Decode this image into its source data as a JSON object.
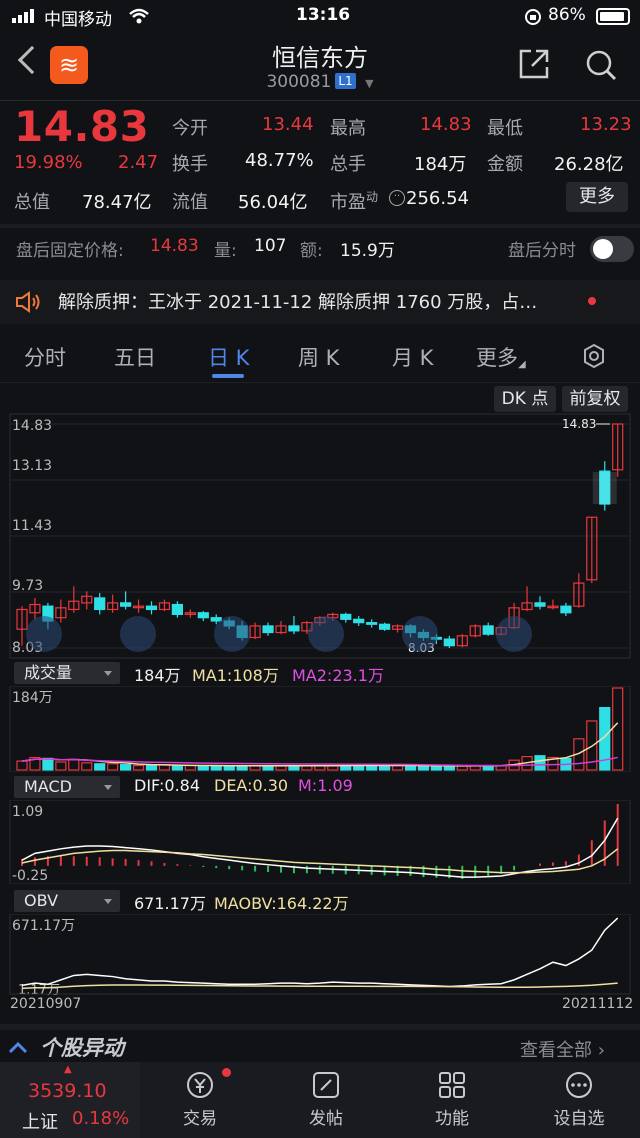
{
  "status": {
    "carrier": "中国移动",
    "time": "13:16",
    "battery": "86%"
  },
  "header": {
    "title": "恒信东方",
    "code": "300081",
    "level": "L1"
  },
  "quote": {
    "price": "14.83",
    "change_pct": "19.98%",
    "change": "2.47",
    "rows": [
      [
        {
          "label": "今开",
          "value": "13.44",
          "color": "red"
        },
        {
          "label": "最高",
          "value": "14.83",
          "color": "red"
        },
        {
          "label": "最低",
          "value": "13.23",
          "color": "red"
        }
      ],
      [
        {
          "label": "换手",
          "value": "48.77%",
          "color": "white"
        },
        {
          "label": "总手",
          "value": "184万",
          "color": "white"
        },
        {
          "label": "金额",
          "value": "26.28亿",
          "color": "white"
        }
      ],
      [
        {
          "label": "总值",
          "value": "78.47亿",
          "color": "white"
        },
        {
          "label": "流值",
          "value": "56.04亿",
          "color": "white"
        },
        {
          "label": "市盈",
          "value": "256.54",
          "color": "white",
          "sup": "动"
        }
      ]
    ],
    "more": "更多"
  },
  "after_hours": {
    "label": "盘后固定价格:",
    "price": "14.83",
    "vol_label": "量:",
    "vol": "107",
    "amt_label": "额:",
    "amt": "15.9万",
    "toggle_label": "盘后分时"
  },
  "notice": {
    "text": "解除质押：王冰于 2021-11-12 解除质押 1760 万股，占…"
  },
  "tabs": [
    "分时",
    "五日",
    "日 K",
    "周 K",
    "月 K",
    "更多"
  ],
  "active_tab": "日 K",
  "chart_buttons": {
    "dk": "DK 点",
    "fq": "前复权"
  },
  "kline": {
    "y_labels": [
      "14.83",
      "13.13",
      "11.43",
      "9.73",
      "8.03"
    ],
    "max_tag": "14.83",
    "min_tag": "8.03",
    "start_date": "20210907",
    "end_date": "20211112"
  },
  "volume": {
    "label": "成交量",
    "value": "184万",
    "ma1": "MA1:108万",
    "ma2": "MA2:23.1万",
    "y_top": "184万"
  },
  "macd": {
    "label": "MACD",
    "dif": "DIF:0.84",
    "dea": "DEA:0.30",
    "m": "M:1.09",
    "y_top": "1.09",
    "y_bottom": "-0.25"
  },
  "obv": {
    "label": "OBV",
    "value": "671.17万",
    "maobv": "MAOBV:164.22万",
    "y_top": "671.17万",
    "y_bottom": "1.17万"
  },
  "bottom_section": {
    "title": "个股异动",
    "link": "查看全部"
  },
  "bottom_nav": {
    "index_value": "3539.10",
    "index_name": "上证",
    "index_pct": "0.18%",
    "items": [
      "交易",
      "发帖",
      "功能",
      "设自选"
    ]
  },
  "colors": {
    "up": "#e8383d",
    "down": "#2ee0e6",
    "accent": "#4f86e8",
    "ma1": "#f0e0a0",
    "ma2": "#d63ad6"
  },
  "chart_data": {
    "type": "candlestick",
    "ylim": [
      8.03,
      14.83
    ],
    "candles": [
      {
        "o": 8.6,
        "c": 9.2,
        "h": 9.3,
        "l": 8.1
      },
      {
        "o": 9.1,
        "c": 9.35,
        "h": 9.55,
        "l": 8.9
      },
      {
        "o": 9.3,
        "c": 8.85,
        "h": 9.4,
        "l": 8.6
      },
      {
        "o": 8.95,
        "c": 9.25,
        "h": 9.5,
        "l": 8.8
      },
      {
        "o": 9.2,
        "c": 9.45,
        "h": 9.9,
        "l": 9.1
      },
      {
        "o": 9.4,
        "c": 9.6,
        "h": 9.75,
        "l": 9.2
      },
      {
        "o": 9.55,
        "c": 9.2,
        "h": 9.7,
        "l": 9.05
      },
      {
        "o": 9.2,
        "c": 9.4,
        "h": 9.65,
        "l": 9.1
      },
      {
        "o": 9.4,
        "c": 9.3,
        "h": 9.75,
        "l": 9.2
      },
      {
        "o": 9.3,
        "c": 9.3,
        "h": 9.5,
        "l": 9.1
      },
      {
        "o": 9.3,
        "c": 9.2,
        "h": 9.45,
        "l": 9.05
      },
      {
        "o": 9.2,
        "c": 9.4,
        "h": 9.5,
        "l": 9.15
      },
      {
        "o": 9.35,
        "c": 9.05,
        "h": 9.45,
        "l": 8.95
      },
      {
        "o": 9.05,
        "c": 9.1,
        "h": 9.2,
        "l": 8.95
      },
      {
        "o": 9.1,
        "c": 8.95,
        "h": 9.15,
        "l": 8.85
      },
      {
        "o": 8.95,
        "c": 8.85,
        "h": 9.05,
        "l": 8.75
      },
      {
        "o": 8.85,
        "c": 8.7,
        "h": 8.95,
        "l": 8.6
      },
      {
        "o": 8.7,
        "c": 8.35,
        "h": 8.85,
        "l": 8.25
      },
      {
        "o": 8.35,
        "c": 8.7,
        "h": 8.8,
        "l": 8.3
      },
      {
        "o": 8.7,
        "c": 8.5,
        "h": 8.8,
        "l": 8.4
      },
      {
        "o": 8.5,
        "c": 8.7,
        "h": 8.85,
        "l": 8.45
      },
      {
        "o": 8.7,
        "c": 8.55,
        "h": 9.0,
        "l": 8.45
      },
      {
        "o": 8.55,
        "c": 8.8,
        "h": 8.85,
        "l": 8.45
      },
      {
        "o": 8.8,
        "c": 8.95,
        "h": 9.0,
        "l": 8.7
      },
      {
        "o": 8.95,
        "c": 9.05,
        "h": 9.1,
        "l": 8.85
      },
      {
        "o": 9.05,
        "c": 8.9,
        "h": 9.1,
        "l": 8.8
      },
      {
        "o": 8.9,
        "c": 8.8,
        "h": 9.0,
        "l": 8.7
      },
      {
        "o": 8.8,
        "c": 8.75,
        "h": 8.9,
        "l": 8.65
      },
      {
        "o": 8.75,
        "c": 8.6,
        "h": 8.8,
        "l": 8.55
      },
      {
        "o": 8.6,
        "c": 8.7,
        "h": 8.75,
        "l": 8.5
      },
      {
        "o": 8.7,
        "c": 8.5,
        "h": 8.75,
        "l": 8.35
      },
      {
        "o": 8.5,
        "c": 8.35,
        "h": 8.6,
        "l": 8.25
      },
      {
        "o": 8.35,
        "c": 8.3,
        "h": 8.45,
        "l": 8.15
      },
      {
        "o": 8.3,
        "c": 8.1,
        "h": 8.4,
        "l": 8.03
      },
      {
        "o": 8.1,
        "c": 8.4,
        "h": 8.45,
        "l": 8.05
      },
      {
        "o": 8.4,
        "c": 8.7,
        "h": 8.75,
        "l": 8.35
      },
      {
        "o": 8.7,
        "c": 8.45,
        "h": 8.8,
        "l": 8.4
      },
      {
        "o": 8.45,
        "c": 8.65,
        "h": 8.7,
        "l": 8.4
      },
      {
        "o": 8.65,
        "c": 9.25,
        "h": 9.4,
        "l": 8.6
      },
      {
        "o": 9.2,
        "c": 9.4,
        "h": 9.9,
        "l": 9.15
      },
      {
        "o": 9.4,
        "c": 9.3,
        "h": 9.6,
        "l": 9.2
      },
      {
        "o": 9.3,
        "c": 9.3,
        "h": 9.5,
        "l": 9.2
      },
      {
        "o": 9.3,
        "c": 9.1,
        "h": 9.4,
        "l": 9.0
      },
      {
        "o": 9.3,
        "c": 10.0,
        "h": 10.3,
        "l": 9.25
      },
      {
        "o": 10.1,
        "c": 12.0,
        "h": 12.0,
        "l": 10.0
      },
      {
        "o": 13.4,
        "c": 12.4,
        "h": 13.7,
        "l": 12.2
      },
      {
        "o": 13.44,
        "c": 14.83,
        "h": 14.83,
        "l": 13.23
      }
    ],
    "volume_max": 184,
    "volumes": [
      20,
      28,
      26,
      18,
      24,
      16,
      14,
      14,
      12,
      10,
      10,
      12,
      10,
      10,
      9,
      9,
      10,
      10,
      10,
      9,
      9,
      9,
      10,
      10,
      10,
      10,
      10,
      10,
      10,
      10,
      10,
      9,
      9,
      9,
      9,
      10,
      10,
      10,
      22,
      30,
      32,
      28,
      26,
      70,
      110,
      140,
      184
    ],
    "macd_bars": [
      0.12,
      0.15,
      0.17,
      0.18,
      0.17,
      0.16,
      0.15,
      0.13,
      0.12,
      0.1,
      0.08,
      0.05,
      0.03,
      0.01,
      -0.02,
      -0.04,
      -0.06,
      -0.08,
      -0.1,
      -0.11,
      -0.12,
      -0.13,
      -0.13,
      -0.14,
      -0.14,
      -0.15,
      -0.15,
      -0.16,
      -0.17,
      -0.18,
      -0.18,
      -0.2,
      -0.21,
      -0.22,
      -0.23,
      -0.21,
      -0.18,
      -0.14,
      -0.08,
      0.0,
      0.04,
      0.06,
      0.08,
      0.2,
      0.45,
      0.8,
      1.09
    ],
    "dif": [
      0.1,
      0.22,
      0.26,
      0.3,
      0.33,
      0.35,
      0.35,
      0.34,
      0.32,
      0.3,
      0.28,
      0.25,
      0.22,
      0.2,
      0.16,
      0.13,
      0.1,
      0.07,
      0.04,
      0.02,
      0.0,
      -0.02,
      -0.04,
      -0.05,
      -0.06,
      -0.07,
      -0.08,
      -0.09,
      -0.1,
      -0.11,
      -0.12,
      -0.14,
      -0.16,
      -0.18,
      -0.2,
      -0.2,
      -0.19,
      -0.18,
      -0.14,
      -0.1,
      -0.07,
      -0.05,
      -0.02,
      0.05,
      0.18,
      0.45,
      0.84
    ],
    "dea": [
      0.05,
      0.1,
      0.14,
      0.18,
      0.22,
      0.24,
      0.26,
      0.27,
      0.27,
      0.26,
      0.25,
      0.24,
      0.23,
      0.21,
      0.2,
      0.18,
      0.16,
      0.14,
      0.12,
      0.1,
      0.08,
      0.06,
      0.05,
      0.04,
      0.03,
      0.02,
      0.01,
      0.0,
      -0.01,
      -0.02,
      -0.03,
      -0.04,
      -0.06,
      -0.07,
      -0.09,
      -0.1,
      -0.11,
      -0.12,
      -0.12,
      -0.12,
      -0.11,
      -0.1,
      -0.08,
      -0.06,
      0.0,
      0.12,
      0.3
    ],
    "obv": [
      60,
      80,
      70,
      110,
      150,
      160,
      150,
      140,
      120,
      110,
      100,
      100,
      90,
      85,
      80,
      75,
      70,
      70,
      70,
      75,
      80,
      80,
      75,
      80,
      90,
      85,
      80,
      80,
      75,
      70,
      65,
      60,
      55,
      50,
      55,
      65,
      70,
      75,
      110,
      160,
      210,
      270,
      240,
      300,
      380,
      560,
      671
    ]
  }
}
